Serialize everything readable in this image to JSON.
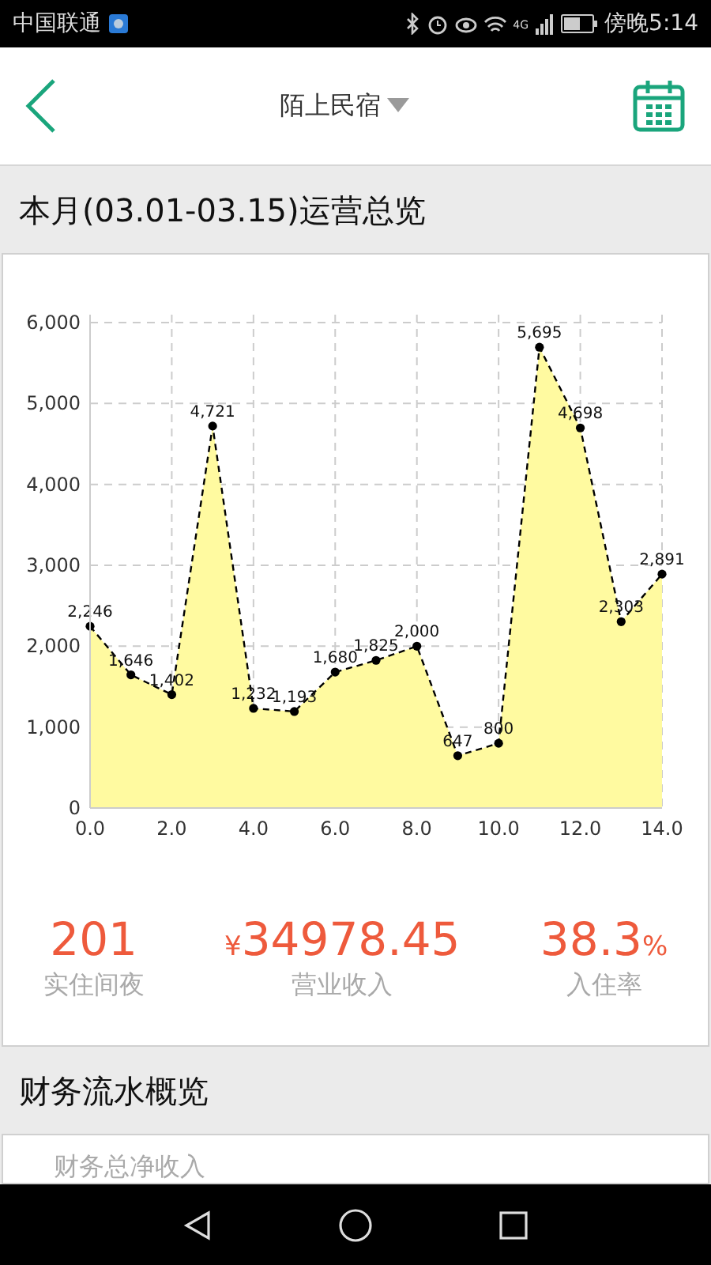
{
  "status_bar": {
    "carrier": "中国联通",
    "indicator_4g": "4G",
    "time": "傍晚5:14"
  },
  "header": {
    "title": "陌上民宿"
  },
  "overview": {
    "heading": "本月(03.01-03.15)运营总览",
    "chart_data": {
      "type": "area",
      "x": [
        0,
        1,
        2,
        3,
        4,
        5,
        6,
        7,
        8,
        9,
        10,
        11,
        12,
        13,
        14
      ],
      "grid": true,
      "series": [
        {
          "color": "#fffaa0",
          "values": [
            2246,
            1646,
            1402,
            4721,
            1232,
            1193,
            1680,
            1825,
            2000,
            647,
            800,
            5695,
            4698,
            2303,
            2891
          ]
        }
      ],
      "value_labels": [
        "2,246",
        "1,646",
        "1,402",
        "4,721",
        "1,232",
        "1,193",
        "1,680",
        "1,825",
        "2,000",
        "647",
        "800",
        "5,695",
        "4,698",
        "2,303",
        "2,891"
      ],
      "xlim": [
        0,
        14
      ],
      "ylim": [
        0,
        6000
      ],
      "xticks": [
        {
          "value": 0,
          "label": "0.0"
        },
        {
          "value": 2,
          "label": "2.0"
        },
        {
          "value": 4,
          "label": "4.0"
        },
        {
          "value": 6,
          "label": "6.0"
        },
        {
          "value": 8,
          "label": "8.0"
        },
        {
          "value": 10,
          "label": "10.0"
        },
        {
          "value": 12,
          "label": "12.0"
        },
        {
          "value": 14,
          "label": "14.0"
        }
      ],
      "yticks": [
        {
          "value": 0,
          "label": "0"
        },
        {
          "value": 1000,
          "label": "1,000"
        },
        {
          "value": 2000,
          "label": "2,000"
        },
        {
          "value": 3000,
          "label": "3,000"
        },
        {
          "value": 4000,
          "label": "4,000"
        },
        {
          "value": 5000,
          "label": "5,000"
        },
        {
          "value": 6000,
          "label": "6,000"
        }
      ]
    },
    "stats": [
      {
        "value": "201",
        "label": "实住间夜"
      },
      {
        "prefix": "¥",
        "value": "34978.45",
        "label": "营业收入"
      },
      {
        "value": "38.3",
        "suffix": "%",
        "label": "入住率"
      }
    ]
  },
  "finance": {
    "heading": "财务流水概览",
    "first_label": "财务总净收入"
  }
}
